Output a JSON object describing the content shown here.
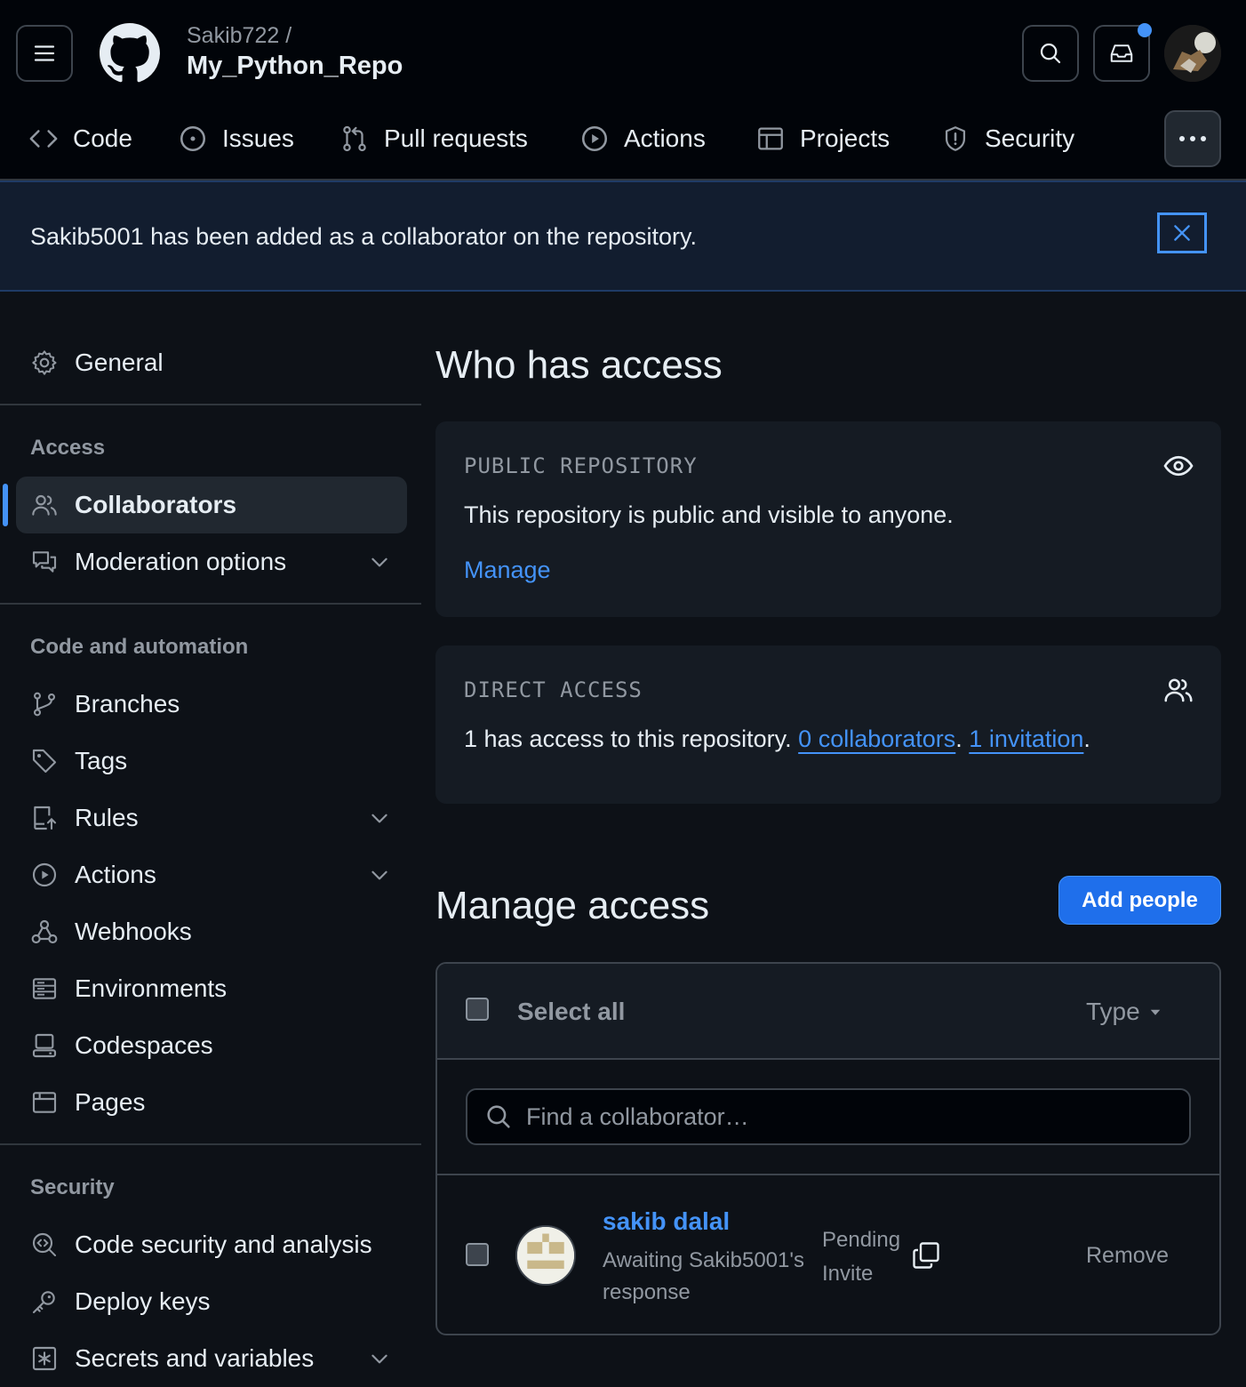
{
  "header": {
    "owner": "Sakib722 /",
    "repo": "My_Python_Repo",
    "notification_indicator": true
  },
  "tabs": [
    {
      "label": "Code",
      "icon": "code-icon"
    },
    {
      "label": "Issues",
      "icon": "issue-icon"
    },
    {
      "label": "Pull requests",
      "icon": "pull-request-icon"
    },
    {
      "label": "Actions",
      "icon": "play-icon"
    },
    {
      "label": "Projects",
      "icon": "table-icon"
    },
    {
      "label": "Security",
      "icon": "shield-icon"
    }
  ],
  "flash": {
    "message": "Sakib5001 has been added as a collaborator on the repository."
  },
  "sidebar": {
    "general": "General",
    "access_heading": "Access",
    "collaborators": "Collaborators",
    "moderation": "Moderation options",
    "code_heading": "Code and automation",
    "branches": "Branches",
    "tags": "Tags",
    "rules": "Rules",
    "actions": "Actions",
    "webhooks": "Webhooks",
    "environments": "Environments",
    "codespaces": "Codespaces",
    "pages": "Pages",
    "security_heading": "Security",
    "code_security": "Code security and analysis",
    "deploy_keys": "Deploy keys",
    "secrets": "Secrets and variables"
  },
  "who_has_access": {
    "title": "Who has access",
    "public": {
      "heading": "PUBLIC REPOSITORY",
      "text": "This repository is public and visible to anyone.",
      "link": "Manage"
    },
    "direct": {
      "heading": "DIRECT ACCESS",
      "prefix": "1 has access to this repository. ",
      "collaborators_link": "0 collaborators",
      "separator": ". ",
      "invitation_link": "1 invitation",
      "suffix": "."
    }
  },
  "manage_access": {
    "title": "Manage access",
    "add_button": "Add people",
    "select_all": "Select all",
    "type_filter": "Type",
    "search_placeholder": "Find a collaborator…",
    "members": [
      {
        "name": "sakib dalal",
        "status_line1": "Awaiting Sakib5001's",
        "status_line2": "response",
        "badge_line1": "Pending",
        "badge_line2": "Invite",
        "action": "Remove"
      }
    ]
  },
  "colors": {
    "background": "#0d1117",
    "header": "#010409",
    "accent": "#4493f8",
    "primary_button": "#1f6feb",
    "flash": "#121d2f"
  }
}
